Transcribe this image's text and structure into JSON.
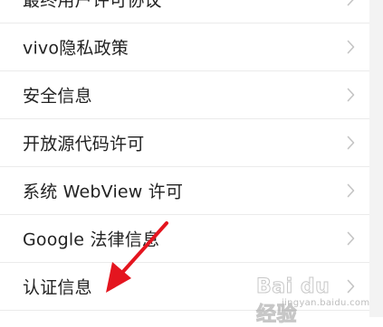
{
  "settings": {
    "items": [
      {
        "label": "最终用户许可协议"
      },
      {
        "label": "vivo隐私政策"
      },
      {
        "label": "安全信息"
      },
      {
        "label": "开放源代码许可"
      },
      {
        "label": "系统 WebView 许可"
      },
      {
        "label": "Google 法律信息"
      },
      {
        "label": "认证信息"
      }
    ],
    "chevron_icon": "chevron-right-icon"
  },
  "watermark": {
    "brand": "Bai du 经验",
    "sub": "jingyan.baidu.com"
  },
  "colors": {
    "text": "#222222",
    "chevron": "#c4c4c4",
    "divider": "#ebebeb",
    "arrow": "#e4151f"
  }
}
